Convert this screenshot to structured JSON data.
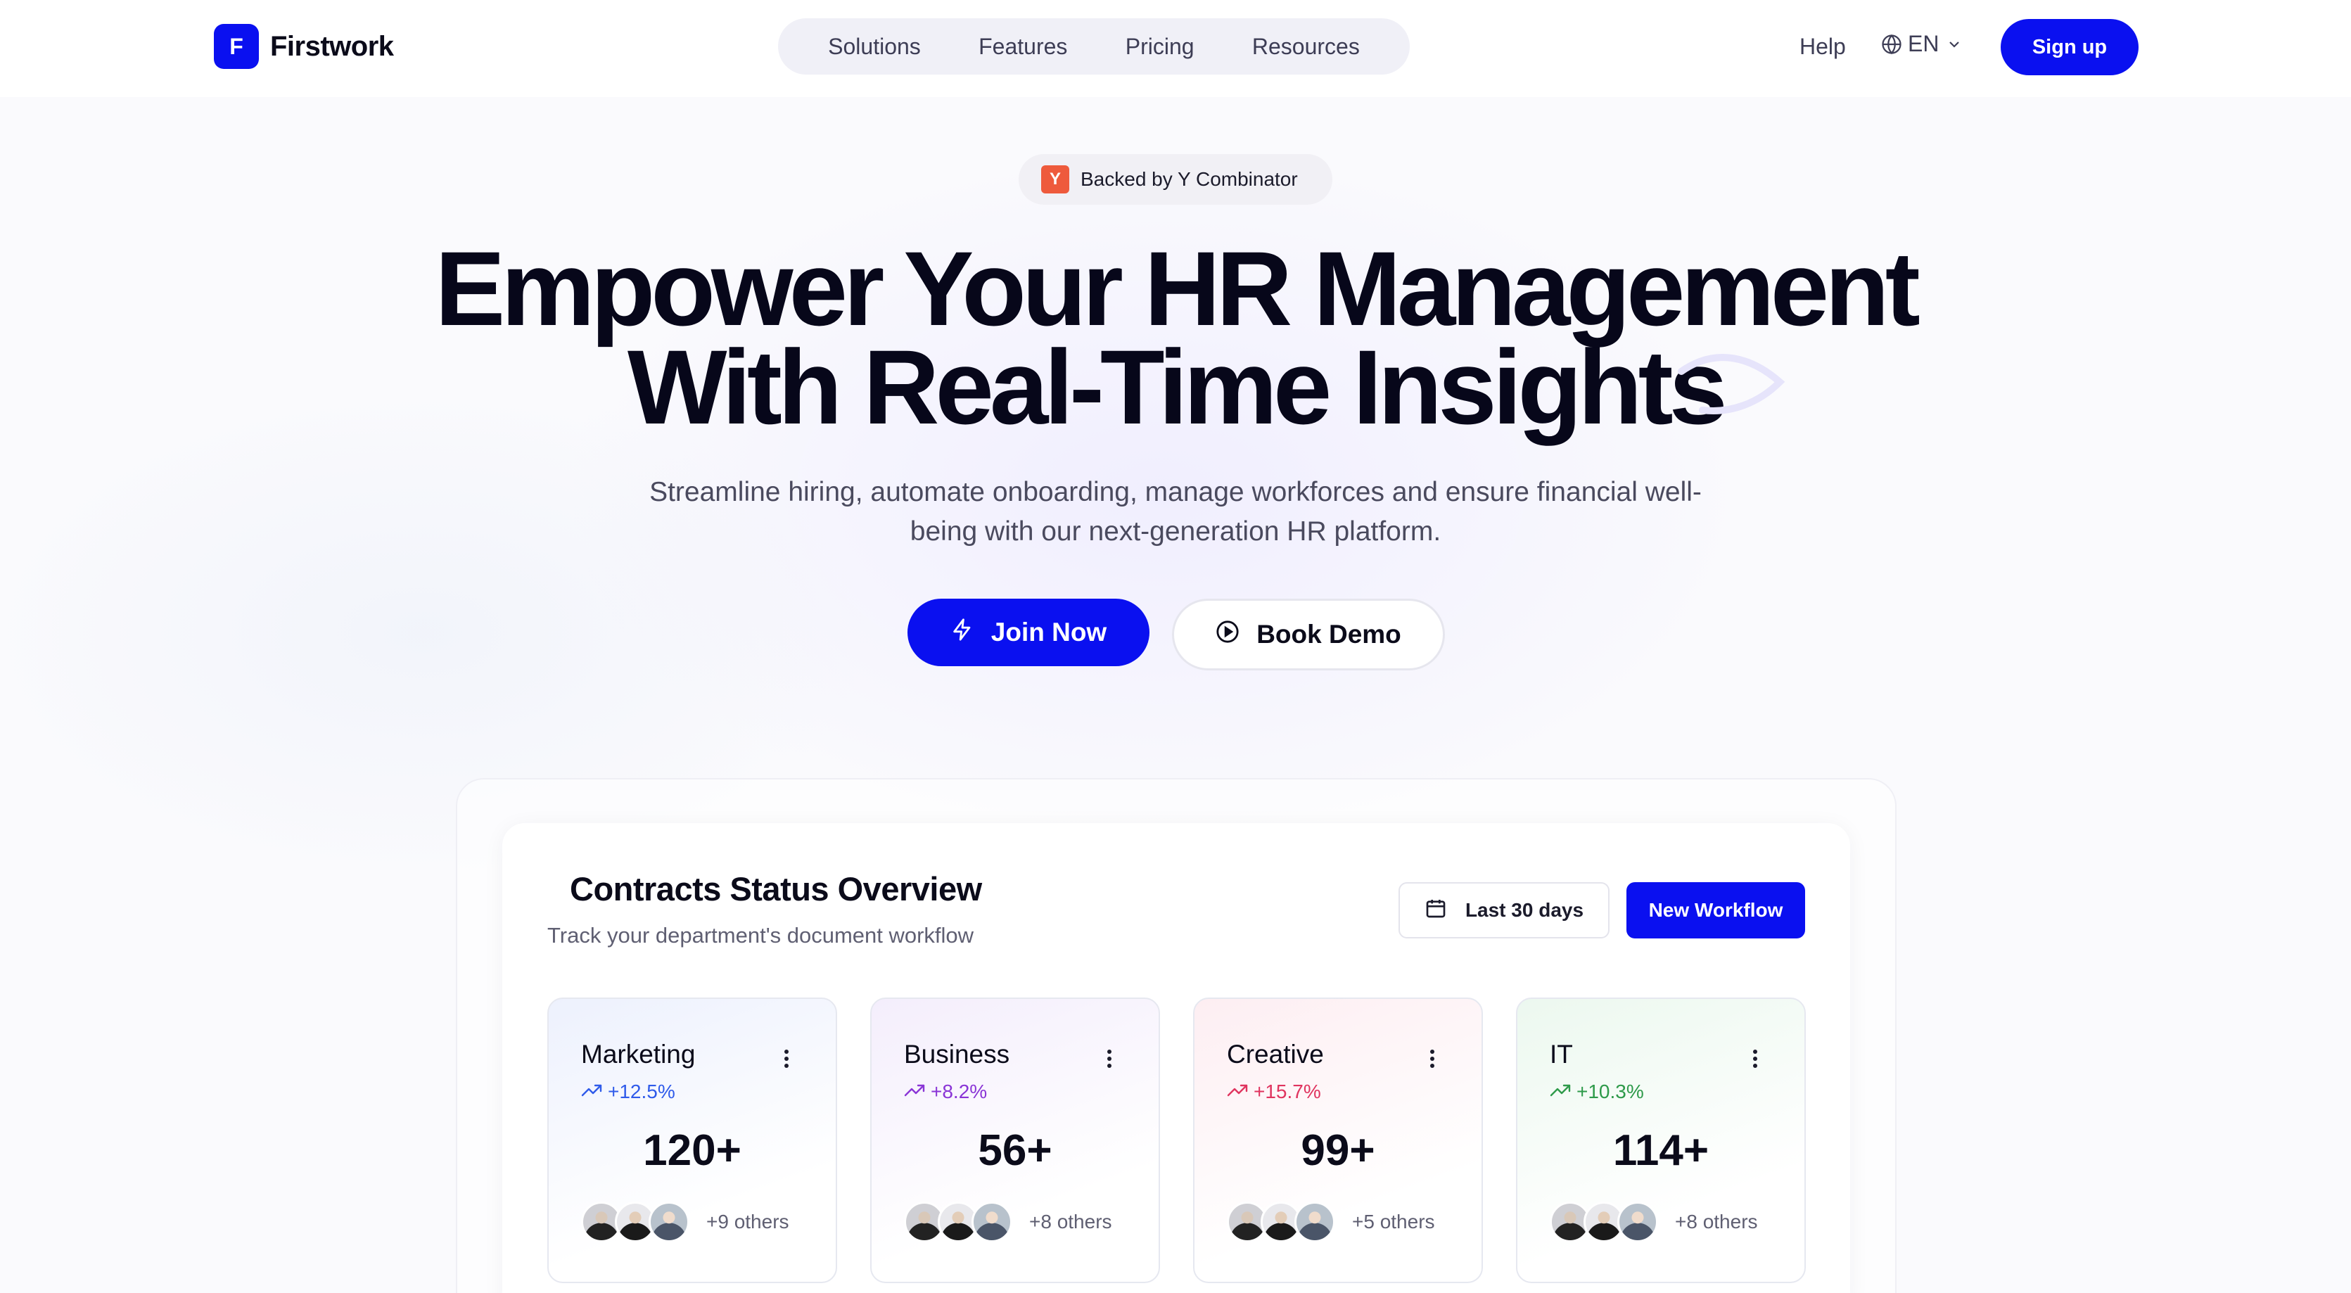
{
  "nav": {
    "brand": "Firstwork",
    "brand_mark": "F",
    "links": [
      "Solutions",
      "Features",
      "Pricing",
      "Resources"
    ],
    "help": "Help",
    "language": "EN",
    "signup": "Sign up"
  },
  "hero": {
    "badge_icon": "Y",
    "badge": "Backed by Y Combinator",
    "title_line1": "Empower Your HR Management",
    "title_line2": "With Real-Time Insights",
    "subtitle": "Streamline hiring, automate onboarding, manage workforces and ensure financial well-being with our next-generation HR platform.",
    "join": "Join Now",
    "demo": "Book Demo"
  },
  "dashboard": {
    "title": "Contracts Status Overview",
    "subtitle": "Track your department's document workflow",
    "range": "Last 30 days",
    "workflow": "New Workflow",
    "cards": [
      {
        "name": "Marketing",
        "trend": "+12.5%",
        "value": "120+",
        "others": "+9 others",
        "color": "#2f5bea",
        "bg": "linear-gradient(160deg,#edf1fd 0%,#ffffff 70%)"
      },
      {
        "name": "Business",
        "trend": "+8.2%",
        "value": "56+",
        "others": "+8 others",
        "color": "#8a35d6",
        "bg": "linear-gradient(160deg,#f4eefc 0%,#ffffff 70%)"
      },
      {
        "name": "Creative",
        "trend": "+15.7%",
        "value": "99+",
        "others": "+5 others",
        "color": "#e0345f",
        "bg": "linear-gradient(160deg,#fdeef2 0%,#ffffff 70%)"
      },
      {
        "name": "IT",
        "trend": "+10.3%",
        "value": "114+",
        "others": "+8 others",
        "color": "#2e9a4a",
        "bg": "linear-gradient(160deg,#ecf8ef 0%,#ffffff 70%)"
      }
    ]
  },
  "colors": {
    "accent": "#0a10f0",
    "yc": "#ee5a3c"
  }
}
